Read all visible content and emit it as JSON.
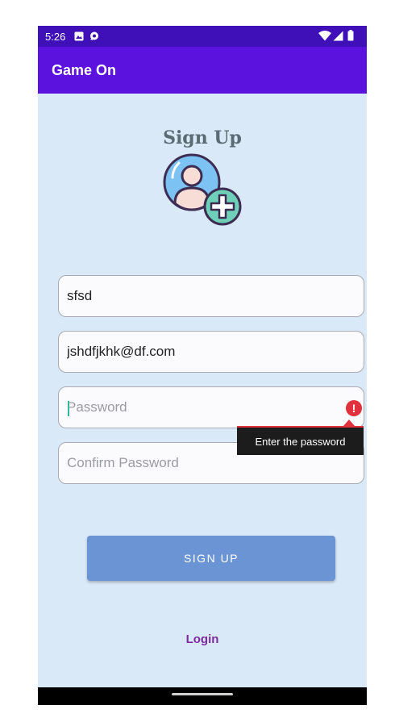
{
  "status_bar": {
    "time": "5:26"
  },
  "app_bar": {
    "title": "Game On"
  },
  "form": {
    "heading": "Sign Up",
    "name_value": "sfsd",
    "email_value": "jshdfjkhk@df.com",
    "password_placeholder": "Password",
    "password_error": "Enter the password",
    "confirm_placeholder": "Confirm Password"
  },
  "actions": {
    "sign_up_label": "SIGN UP",
    "login_label": "Login"
  },
  "colors": {
    "status_bar": "#3f0fb8",
    "app_bar": "#5c12de",
    "background": "#d9e9f8",
    "button": "#6a94d4",
    "login_text": "#7b2b9e",
    "error": "#e0313d"
  },
  "icons": [
    "image-notification-icon",
    "chat-notification-icon",
    "wifi-icon",
    "signal-icon",
    "battery-icon",
    "add-user-icon",
    "error-icon"
  ]
}
